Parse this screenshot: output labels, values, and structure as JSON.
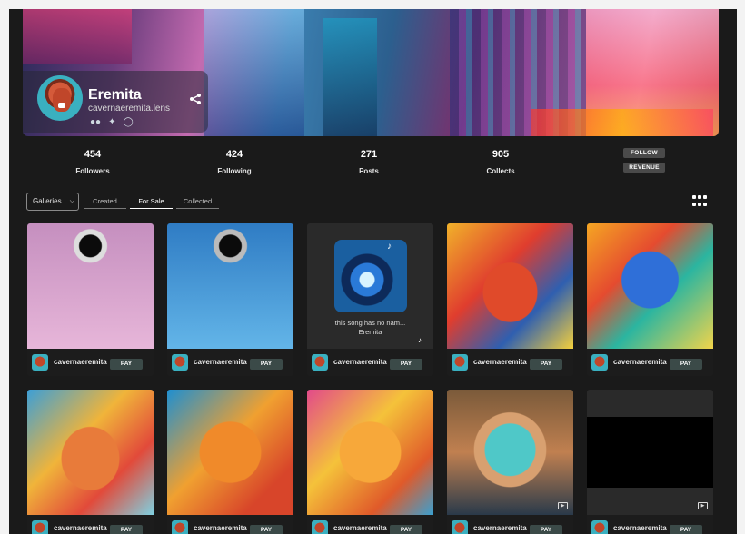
{
  "profile": {
    "name": "Eremita",
    "handle": "cavernaeremita.lens",
    "social_icons": [
      "lens-icon",
      "twitter-icon",
      "globe-icon"
    ]
  },
  "stats": [
    {
      "value": "454",
      "label": "Followers"
    },
    {
      "value": "424",
      "label": "Following"
    },
    {
      "value": "271",
      "label": "Posts"
    },
    {
      "value": "905",
      "label": "Collects"
    }
  ],
  "actions": {
    "follow": "FOLLOW",
    "revenue": "REVENUE"
  },
  "filters": {
    "galleries": "Galleries",
    "tabs": [
      "Created",
      "For Sale",
      "Collected"
    ],
    "active_tab": "For Sale"
  },
  "cards": [
    {
      "user": "cavernaeremita",
      "pay": "PAY",
      "image": "robot-pink"
    },
    {
      "user": "cavernaeremita",
      "pay": "PAY",
      "image": "robot-blue"
    },
    {
      "user": "cavernaeremita",
      "pay": "PAY",
      "image": "song-cover",
      "title": "this song has no nam...",
      "artist": "Eremita"
    },
    {
      "user": "cavernaeremita",
      "pay": "PAY",
      "image": "paint-face-1"
    },
    {
      "user": "cavernaeremita",
      "pay": "PAY",
      "image": "paint-face-2"
    },
    {
      "user": "cavernaeremita",
      "pay": "PAY",
      "image": "paint-face-3"
    },
    {
      "user": "cavernaeremita",
      "pay": "PAY",
      "image": "paint-face-4"
    },
    {
      "user": "cavernaeremita",
      "pay": "PAY",
      "image": "paint-face-5"
    },
    {
      "user": "cavernaeremita",
      "pay": "PAY",
      "image": "portrait"
    },
    {
      "user": "cavernaeremita",
      "pay": "PAY",
      "image": "video-blank"
    }
  ],
  "colors": {
    "background": "#1a1a1a",
    "pay_button": "#3b4a48",
    "tag_button": "#4a4a4a"
  }
}
